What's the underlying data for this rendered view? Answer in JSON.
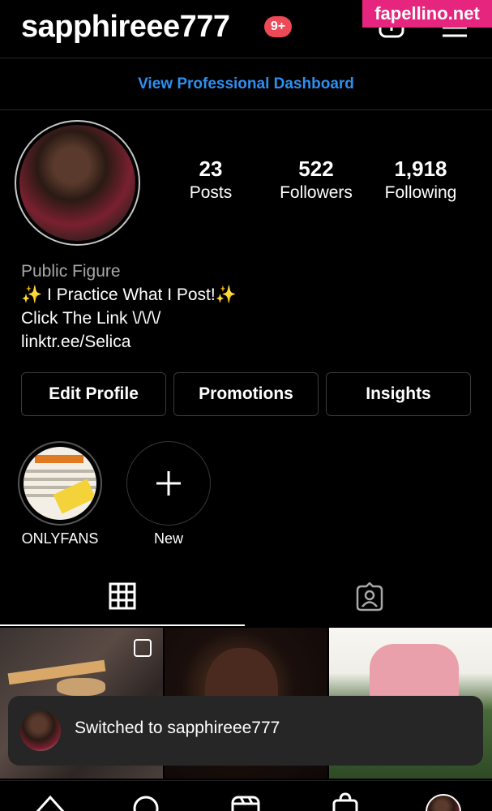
{
  "header": {
    "username": "sapphireee777",
    "notification_badge": "9+",
    "icons": [
      "new-post-icon",
      "menu-icon"
    ]
  },
  "watermark": "fapellino.net",
  "dashboard_link": "View Professional Dashboard",
  "stats": [
    {
      "value": "23",
      "label": "Posts"
    },
    {
      "value": "522",
      "label": "Followers"
    },
    {
      "value": "1,918",
      "label": "Following"
    }
  ],
  "bio": {
    "category": "Public Figure",
    "line1": "✨ I Practice What I Post!✨",
    "line2": "Click The Link \\/\\/\\/",
    "link": "linktr.ee/Selica"
  },
  "buttons": {
    "edit_profile": "Edit Profile",
    "promotions": "Promotions",
    "insights": "Insights"
  },
  "highlights": [
    {
      "label": "ONLYFANS"
    },
    {
      "label": "New"
    }
  ],
  "tabs": [
    "grid-icon",
    "tagged-icon"
  ],
  "toast": {
    "text": "Switched to sapphireee777"
  },
  "bottom_nav": [
    "home-icon",
    "search-icon",
    "reels-icon",
    "shop-icon",
    "profile-avatar"
  ],
  "colors": {
    "background": "#000000",
    "link_blue": "#2f8ff0",
    "badge_red": "#ed4956",
    "watermark_pink": "#e6267e"
  }
}
